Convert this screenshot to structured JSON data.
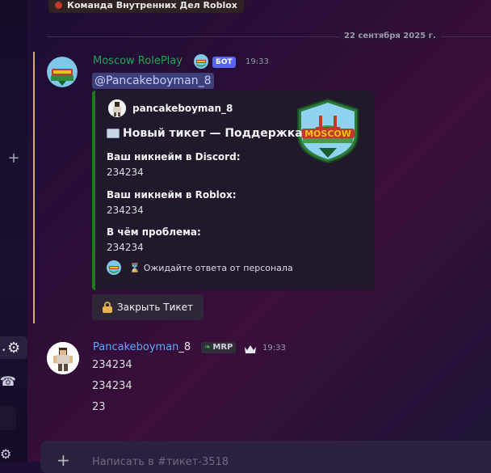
{
  "top_pill": {
    "label": "Команда Внутренних Дел Roblox"
  },
  "date_divider": "22 сентября 2025 г.",
  "bot_message": {
    "author": "Moscow RolePlay",
    "badge": "БОТ",
    "time": "19:33",
    "mention": "@Pancakeboyman_8",
    "embed": {
      "author": "pancakeboyman_8",
      "title": "Новый тикет — Поддержка",
      "fields": [
        {
          "name": "Ваш никнейм в Discord:",
          "value": "234234"
        },
        {
          "name": "Ваш никнейм в Roblox:",
          "value": "234234"
        },
        {
          "name": "В чём проблема:",
          "value": "234234"
        }
      ],
      "footer": "Ожидайте ответа от персонала",
      "accent_color": "#1f7a1f",
      "thumbnail_text": "MOSCOW"
    },
    "button_label": "Закрыть Тикет"
  },
  "user_message": {
    "author_highlight": "Pancakeboyman",
    "author_rest": "_8",
    "tag": "MRP",
    "time": "19:33",
    "lines": [
      "234234",
      "234234",
      "23"
    ]
  },
  "input": {
    "placeholder": "Написать в #тикет-3518"
  },
  "colors": {
    "mention_bg": "#3c3f7a",
    "bot_tag": "#5865f2",
    "bot_name": "#25a35a",
    "user_name": "#5aa9ff"
  }
}
